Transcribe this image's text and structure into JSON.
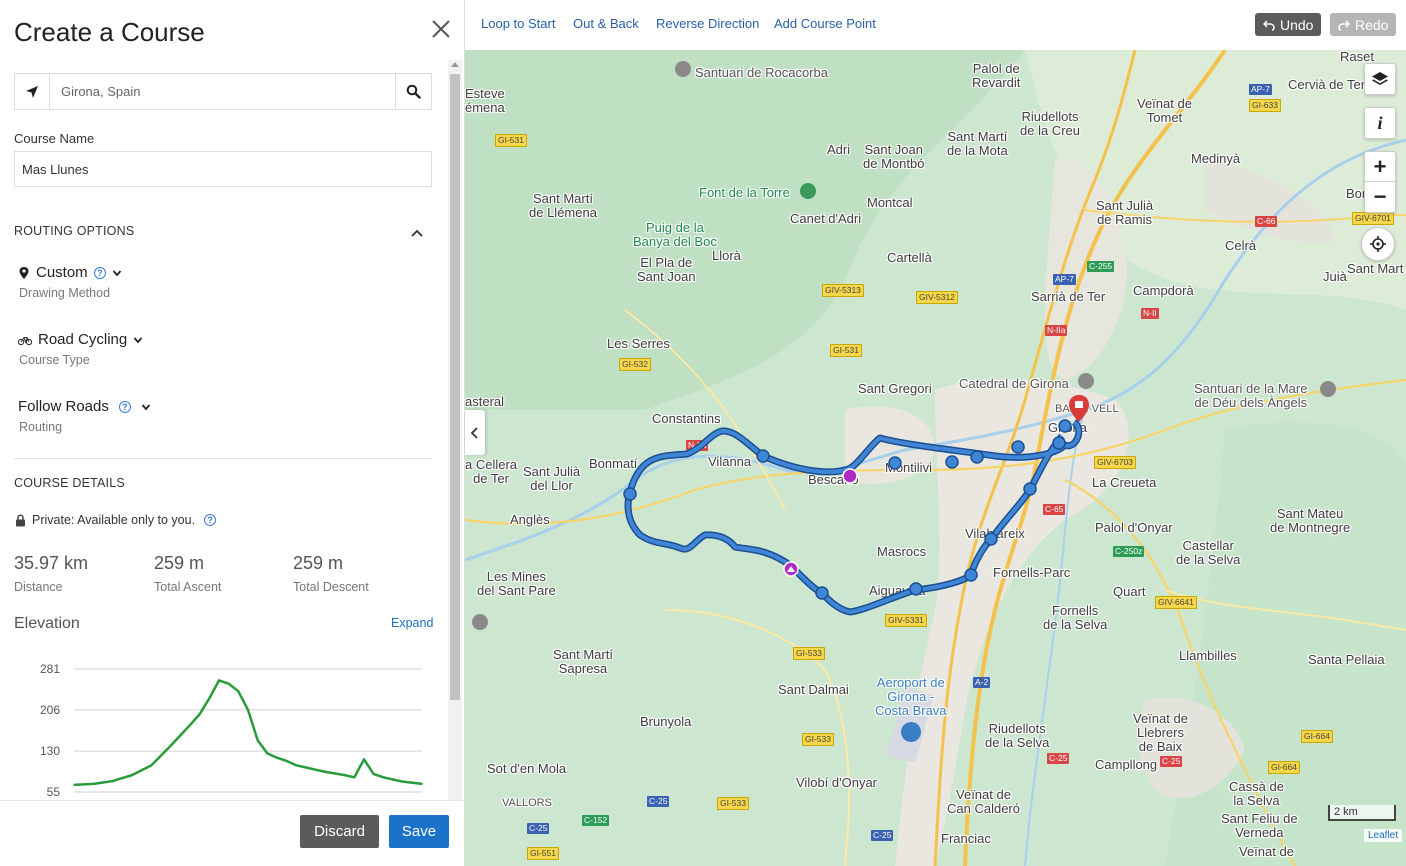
{
  "panel": {
    "title": "Create a Course",
    "search": {
      "value": "Girona, Spain"
    },
    "course_name_label": "Course Name",
    "course_name_value": "Mas Llunes",
    "routing_header": "ROUTING OPTIONS",
    "options": [
      {
        "value": "Custom",
        "label": "Drawing Method",
        "icon": "map-pin-icon"
      },
      {
        "value": "Road Cycling",
        "label": "Course Type",
        "icon": "bicycle-icon"
      },
      {
        "value": "Follow Roads",
        "label": "Routing"
      }
    ],
    "details_header": "COURSE DETAILS",
    "privacy": "Private: Available only to you.",
    "stats": [
      {
        "value": "35.97 km",
        "label": "Distance"
      },
      {
        "value": "259 m",
        "label": "Total Ascent"
      },
      {
        "value": "259 m",
        "label": "Total Descent"
      }
    ],
    "elevation_title": "Elevation",
    "expand_label": "Expand",
    "discard_label": "Discard",
    "save_label": "Save"
  },
  "chart_data": {
    "type": "line",
    "title": "",
    "xlabel": "",
    "ylabel": "",
    "y_ticks": [
      55,
      130,
      206,
      281
    ],
    "ylim": [
      55,
      281
    ],
    "grid": true,
    "color": "#2a9b3a",
    "x": [
      0,
      2,
      4,
      6,
      8,
      10,
      12,
      13,
      14,
      15,
      16,
      17,
      18,
      19,
      20,
      21,
      22,
      23,
      24,
      25,
      26,
      27,
      28,
      29,
      30,
      31,
      32,
      33,
      34,
      35,
      36
    ],
    "y": [
      68,
      70,
      75,
      86,
      104,
      140,
      178,
      198,
      227,
      260,
      254,
      240,
      206,
      150,
      126,
      118,
      112,
      104,
      100,
      96,
      92,
      89,
      86,
      82,
      115,
      88,
      82,
      78,
      74,
      72,
      70
    ]
  },
  "toolbar": {
    "links": [
      "Loop to Start",
      "Out & Back",
      "Reverse Direction",
      "Add Course Point"
    ],
    "undo_label": "Undo",
    "redo_label": "Redo"
  },
  "map": {
    "places": [
      {
        "name": "Santuari de Rocacorba",
        "cls": "gray"
      },
      {
        "name": "Palol de\nRevardit",
        "cls": ""
      },
      {
        "name": "Esteve\némena",
        "cls": ""
      },
      {
        "name": "Riudellots\nde la Creu",
        "cls": ""
      },
      {
        "name": "Veïnat de\nTomet",
        "cls": ""
      },
      {
        "name": "Cervià de Ter",
        "cls": ""
      },
      {
        "name": "Raset",
        "cls": ""
      },
      {
        "name": "Adri",
        "cls": ""
      },
      {
        "name": "Sant Joan\nde Montbó",
        "cls": ""
      },
      {
        "name": "Sant Martí\nde la Mota",
        "cls": ""
      },
      {
        "name": "Medinyà",
        "cls": ""
      },
      {
        "name": "Font de la Torre",
        "cls": "poi-green"
      },
      {
        "name": "Canet d'Adri",
        "cls": ""
      },
      {
        "name": "Montcal",
        "cls": ""
      },
      {
        "name": "Sant Julià\nde Ramis",
        "cls": ""
      },
      {
        "name": "Bordil",
        "cls": ""
      },
      {
        "name": "Sant Martí\nde Llémena",
        "cls": ""
      },
      {
        "name": "Puig de la\nBanya del Boc",
        "cls": "poi-green"
      },
      {
        "name": "El Pla de\nSant Joan",
        "cls": ""
      },
      {
        "name": "Llorà",
        "cls": ""
      },
      {
        "name": "Cartellà",
        "cls": ""
      },
      {
        "name": "Celrà",
        "cls": ""
      },
      {
        "name": "Juià",
        "cls": ""
      },
      {
        "name": "Sant Mart",
        "cls": ""
      },
      {
        "name": "Sarrià de Ter",
        "cls": ""
      },
      {
        "name": "Campdorà",
        "cls": ""
      },
      {
        "name": "Les Serres",
        "cls": ""
      },
      {
        "name": "Sant Gregori",
        "cls": ""
      },
      {
        "name": "Catedral de Girona",
        "cls": "gray"
      },
      {
        "name": "Santuari de la Mare\nde Déu dels Àngels",
        "cls": "gray"
      },
      {
        "name": "asteral",
        "cls": ""
      },
      {
        "name": "Constantins",
        "cls": ""
      },
      {
        "name": "Girona",
        "cls": ""
      },
      {
        "name": "BARRI VELL",
        "cls": "small gray"
      },
      {
        "name": "Vilanna",
        "cls": ""
      },
      {
        "name": "Montilivi",
        "cls": ""
      },
      {
        "name": "Bescanó",
        "cls": ""
      },
      {
        "name": "a Cellera\nde Ter",
        "cls": ""
      },
      {
        "name": "Sant Julià\ndel Llor",
        "cls": ""
      },
      {
        "name": "Bonmatí",
        "cls": ""
      },
      {
        "name": "La Creueta",
        "cls": ""
      },
      {
        "name": "Anglès",
        "cls": ""
      },
      {
        "name": "Palol d'Onyar",
        "cls": ""
      },
      {
        "name": "Sant Mateu\nde Montnegre",
        "cls": ""
      },
      {
        "name": "Vilablareix",
        "cls": ""
      },
      {
        "name": "Masrocs",
        "cls": ""
      },
      {
        "name": "Castellar\nde la Selva",
        "cls": ""
      },
      {
        "name": "Fornells-Parc",
        "cls": ""
      },
      {
        "name": "Les Mines\ndel Sant Pare",
        "cls": ""
      },
      {
        "name": "Aiguaviva",
        "cls": ""
      },
      {
        "name": "Quart",
        "cls": ""
      },
      {
        "name": "Fornells\nde la Selva",
        "cls": ""
      },
      {
        "name": "Sant Martí\nSapresa",
        "cls": ""
      },
      {
        "name": "Llambilles",
        "cls": ""
      },
      {
        "name": "Santa Pellaia",
        "cls": ""
      },
      {
        "name": "Aeroport de\nGirona -\nCosta Brava",
        "cls": "poi-blue"
      },
      {
        "name": "Sant Dalmai",
        "cls": ""
      },
      {
        "name": "Brunyola",
        "cls": ""
      },
      {
        "name": "Riudellots\nde la Selva",
        "cls": ""
      },
      {
        "name": "Veïnat de\nLlebrers\nde Baix",
        "cls": ""
      },
      {
        "name": "Sot d'en Mola",
        "cls": ""
      },
      {
        "name": "Campllong",
        "cls": ""
      },
      {
        "name": "VALLORS",
        "cls": "small gray"
      },
      {
        "name": "Vilobí d'Onyar",
        "cls": ""
      },
      {
        "name": "Cassà de\nla Selva",
        "cls": ""
      },
      {
        "name": "Veïnat de\nCan Calderó",
        "cls": ""
      },
      {
        "name": "Sant Feliu de\nVerneda",
        "cls": ""
      },
      {
        "name": "Franciac",
        "cls": ""
      },
      {
        "name": "Veïnat de",
        "cls": ""
      }
    ],
    "roads": [
      {
        "name": "AP-7",
        "cls": "b"
      },
      {
        "name": "AP-7",
        "cls": "b"
      },
      {
        "name": "GI-633",
        "cls": "y"
      },
      {
        "name": "GI-531",
        "cls": "y"
      },
      {
        "name": "C-66",
        "cls": "r"
      },
      {
        "name": "GIV-6701",
        "cls": "y"
      },
      {
        "name": "C-255",
        "cls": "g"
      },
      {
        "name": "GIV-5313",
        "cls": "y"
      },
      {
        "name": "GIV-5312",
        "cls": "y"
      },
      {
        "name": "N-IIa",
        "cls": "r"
      },
      {
        "name": "N-II",
        "cls": "r"
      },
      {
        "name": "GI-531",
        "cls": "y"
      },
      {
        "name": "GI-532",
        "cls": "y"
      },
      {
        "name": "GIV-6703",
        "cls": "y"
      },
      {
        "name": "N-IIa",
        "cls": "r"
      },
      {
        "name": "C-65",
        "cls": "r"
      },
      {
        "name": "C-250z",
        "cls": "g"
      },
      {
        "name": "GIV-6641",
        "cls": "y"
      },
      {
        "name": "GIV-5331",
        "cls": "y"
      },
      {
        "name": "GI-533",
        "cls": "y"
      },
      {
        "name": "A-2",
        "cls": "b"
      },
      {
        "name": "GI-664",
        "cls": "y"
      },
      {
        "name": "GI-533",
        "cls": "y"
      },
      {
        "name": "C-25",
        "cls": "r"
      },
      {
        "name": "C-25",
        "cls": "r"
      },
      {
        "name": "GI-664",
        "cls": "y"
      },
      {
        "name": "C-25",
        "cls": "b"
      },
      {
        "name": "GI-533",
        "cls": "y"
      },
      {
        "name": "C-152",
        "cls": "g"
      },
      {
        "name": "C-25",
        "cls": "b"
      },
      {
        "name": "C-25",
        "cls": "b"
      },
      {
        "name": "GI-551",
        "cls": "y"
      },
      {
        "name": "AP-7",
        "cls": "b"
      }
    ],
    "scale_label": "2 km",
    "attribution": "Leaflet"
  }
}
